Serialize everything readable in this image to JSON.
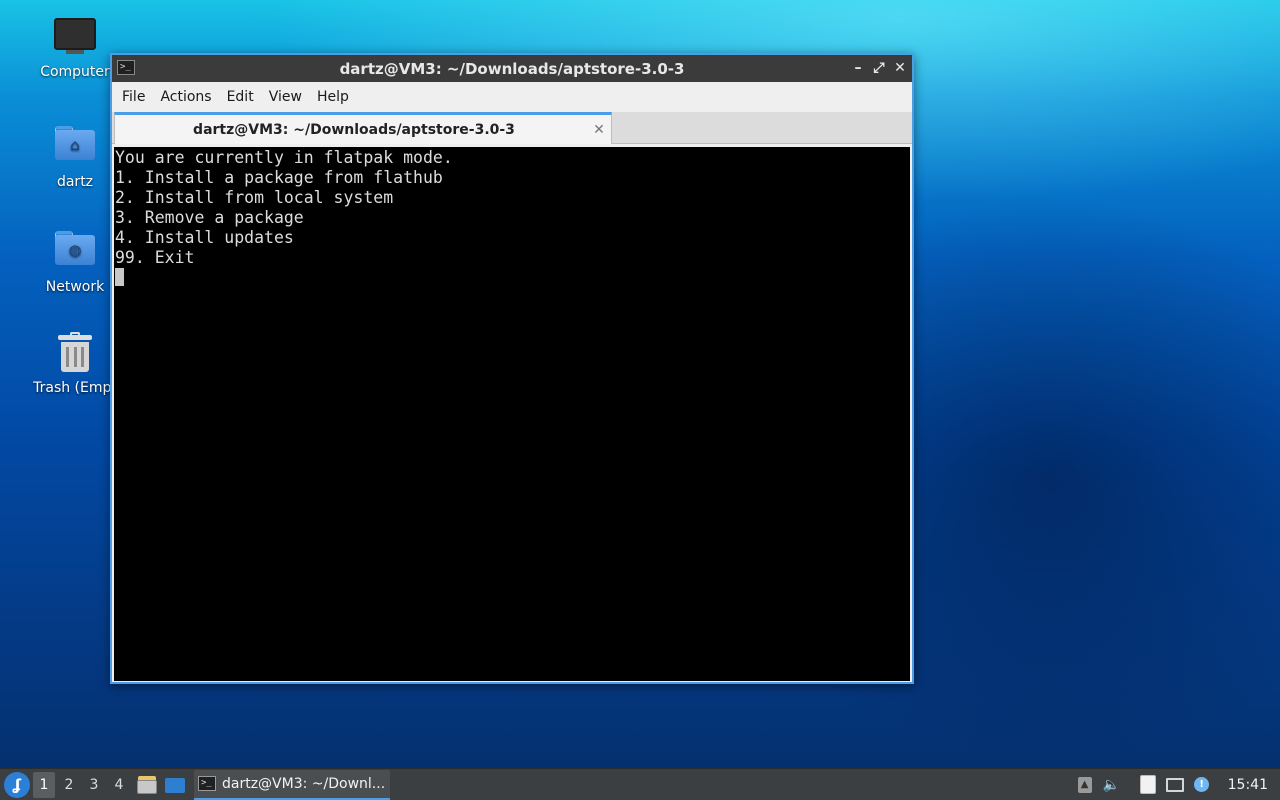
{
  "desktop": {
    "icons": [
      {
        "label": "Computer",
        "icon": "computer-icon"
      },
      {
        "label": "dartz",
        "icon": "home-folder-icon"
      },
      {
        "label": "Network",
        "icon": "network-folder-icon"
      },
      {
        "label": "Trash (Empt",
        "icon": "trash-icon"
      }
    ]
  },
  "window": {
    "title": "dartz@VM3: ~/Downloads/aptstore-3.0-3",
    "controls": {
      "minimize": "–",
      "maximize": "⤢",
      "close": "✕"
    },
    "menu": [
      "File",
      "Actions",
      "Edit",
      "View",
      "Help"
    ],
    "tab": {
      "title": "dartz@VM3: ~/Downloads/aptstore-3.0-3",
      "close": "✕"
    },
    "terminal_lines": [
      "You are currently in flatpak mode.",
      "1. Install a package from flathub",
      "2. Install from local system",
      "3. Remove a package",
      "4. Install updates",
      "99. Exit"
    ]
  },
  "taskbar": {
    "workspaces": [
      "1",
      "2",
      "3",
      "4"
    ],
    "active_workspace": "1",
    "task_label": "dartz@VM3: ~/Downl...",
    "clock": "15:41"
  },
  "colors": {
    "accent": "#4c9de8",
    "titlebar": "#3b3b3b",
    "terminal_bg": "#000000",
    "taskbar": "#3c3f41"
  }
}
